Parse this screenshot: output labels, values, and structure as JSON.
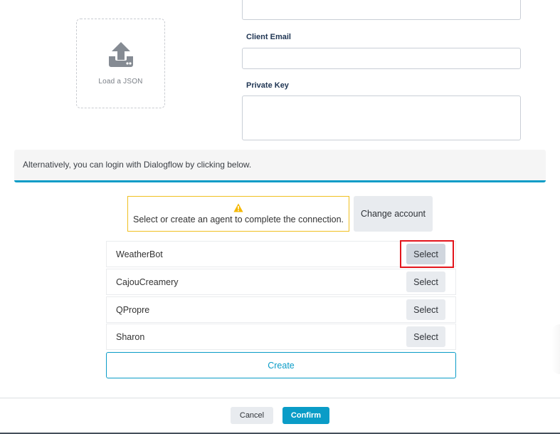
{
  "upload": {
    "icon": "upload-tray-icon",
    "label": "Load a JSON"
  },
  "form": {
    "top_field": {
      "value": "",
      "placeholder": ""
    },
    "client_email": {
      "label": "Client Email",
      "value": "",
      "placeholder": ""
    },
    "private_key": {
      "label": "Private Key",
      "value": "",
      "placeholder": ""
    }
  },
  "info_bar": {
    "text": "Alternatively, you can login with Dialogflow by clicking below."
  },
  "warning": {
    "icon": "warning-triangle-icon",
    "text": "Select or create an agent to complete the connection."
  },
  "change_account_label": "Change account",
  "agents": [
    {
      "name": "WeatherBot",
      "button": "Select",
      "highlighted": true
    },
    {
      "name": "CajouCreamery",
      "button": "Select",
      "highlighted": false
    },
    {
      "name": "QPropre",
      "button": "Select",
      "highlighted": false
    },
    {
      "name": "Sharon",
      "button": "Select",
      "highlighted": false
    }
  ],
  "create_label": "Create",
  "footer": {
    "cancel_label": "Cancel",
    "confirm_label": "Confirm"
  },
  "colors": {
    "accent": "#0a9cc7",
    "warning": "#f0c020",
    "highlight": "#e3141b",
    "label": "#1f3553"
  }
}
